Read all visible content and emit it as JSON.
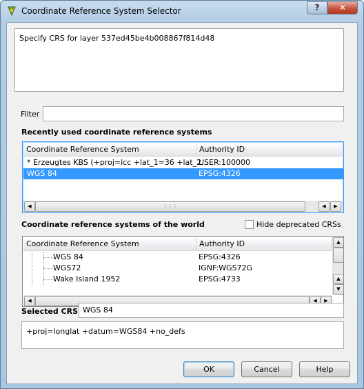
{
  "window": {
    "title": "Coordinate Reference System Selector",
    "help_symbol": "?",
    "close_symbol": "✕"
  },
  "message": "Specify CRS for layer 537ed45be4b008867f814d48",
  "filter": {
    "label": "Filter",
    "value": ""
  },
  "recent": {
    "heading": "Recently used coordinate reference systems",
    "columns": [
      "Coordinate Reference System",
      "Authority ID"
    ],
    "rows": [
      {
        "crs": "* Erzeugtes KBS (+proj=lcc +lat_1=36 +lat_2...",
        "authority": "USER:100000",
        "selected": false
      },
      {
        "crs": "WGS 84",
        "authority": "EPSG:4326",
        "selected": true
      }
    ]
  },
  "world": {
    "heading": "Coordinate reference systems of the world",
    "hide_deprecated_label": "Hide deprecated CRSs",
    "hide_deprecated_checked": false,
    "columns": [
      "Coordinate Reference System",
      "Authority ID"
    ],
    "rows": [
      {
        "crs": "WGS 84",
        "authority": "EPSG:4326"
      },
      {
        "crs": "WGS72",
        "authority": "IGNF:WGS72G"
      },
      {
        "crs": "Wake Island 1952",
        "authority": "EPSG:4733"
      }
    ]
  },
  "selected": {
    "label": "Selected CRS:",
    "value": "WGS 84",
    "proj": "+proj=longlat +datum=WGS84 +no_defs"
  },
  "buttons": {
    "ok": "OK",
    "cancel": "Cancel",
    "help": "Help"
  }
}
